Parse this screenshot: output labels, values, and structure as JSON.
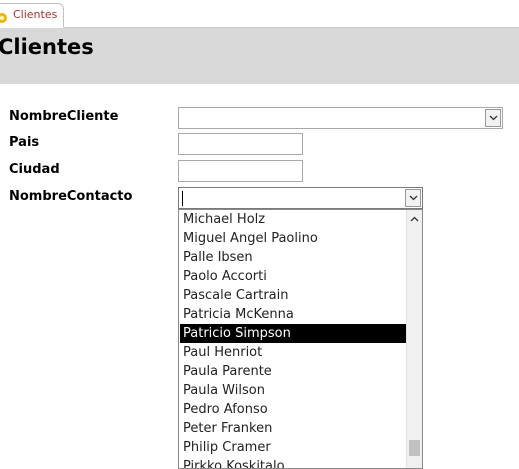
{
  "tab": {
    "label": "Clientes"
  },
  "form": {
    "title": "Clientes",
    "fields": {
      "nombre_cliente": {
        "label": "NombreCliente",
        "value": ""
      },
      "pais": {
        "label": "Pais",
        "value": ""
      },
      "ciudad": {
        "label": "Ciudad",
        "value": ""
      },
      "nombre_contacto": {
        "label": "NombreContacto",
        "value": ""
      }
    }
  },
  "dropdown": {
    "items": [
      "Michael Holz",
      "Miguel Angel Paolino",
      "Palle Ibsen",
      "Paolo Accorti",
      "Pascale Cartrain",
      "Patricia McKenna",
      "Patricio Simpson",
      "Paul Henriot",
      "Paula Parente",
      "Paula Wilson",
      "Pedro Afonso",
      "Peter Franken",
      "Philip Cramer",
      "Pirkko Koskitalo"
    ],
    "selected_index": 6
  },
  "colors": {
    "tab_text": "#a33434",
    "header_band": "#d9d9d9",
    "selection": "#000000"
  },
  "icons": {
    "tab": "form-icon",
    "dropdown": "chevron-down-icon",
    "scroll_up": "chevron-up-icon"
  }
}
